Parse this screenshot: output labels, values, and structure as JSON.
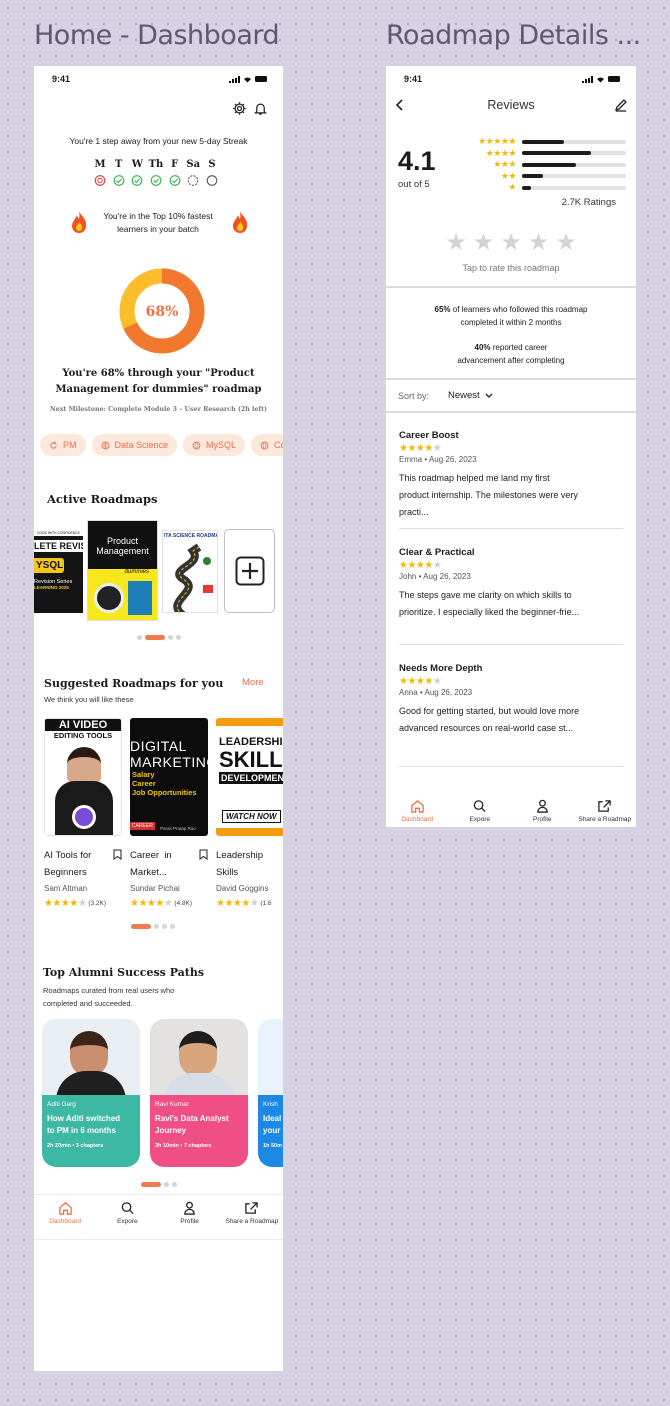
{
  "frames": {
    "home_title": "Home - Dashboard",
    "details_title": "Roadmap Details ..."
  },
  "colors": {
    "accent": "#EF6F45",
    "star": "#F5B800",
    "teal": "#3DB8A5",
    "pink": "#F04F86",
    "blue": "#1E88E5"
  },
  "home": {
    "time": "9:41",
    "streak_text": "You're 1 step away from your new 5-day Streak",
    "days": [
      "M",
      "T",
      "W",
      "Th",
      "F",
      "Sa",
      "S"
    ],
    "top_text_1": "You're in the Top 10% fastest",
    "top_text_2": "learners in your batch",
    "progress_label": "68%",
    "progress_value": 0.68,
    "progress_text_1": "You're 68% through your \"Product",
    "progress_text_2": "Management for dummies\" roadmap",
    "milestone": "Next Milestone: Complete Module 3 – User Research (2h left)",
    "chips": [
      "PM",
      "Data Science",
      "MySQL",
      "Co"
    ],
    "active_title": "Active Roadmaps",
    "books": {
      "mysql": {
        "top": "CODE WITH CONFIDENCE",
        "band": "LETE REVISI",
        "big": "YSQL",
        "note": "Revision Series",
        "year": "LEARNING 2025"
      },
      "pm": {
        "l1": "Product",
        "l2": "Management",
        "l3": "dummies"
      },
      "ds": {
        "title": "ITA SCIENCE ROADMA"
      }
    },
    "suggested": {
      "title": "Suggested Roadmaps for you",
      "more": "More",
      "subtitle": "We think you will like these",
      "items": [
        {
          "cover_1": "AI VIDEO",
          "cover_2": "EDITING TOOLS",
          "title_1": "AI Tools for",
          "title_2": "Beginners",
          "author": "Sam Altman",
          "count": "(3.2K)"
        },
        {
          "cover_1": "DIGITAL",
          "cover_2": "MARKETING",
          "cover_3": "Salary",
          "cover_4": "Career",
          "cover_5": "Job Opportunities",
          "cover_6": "CAREER",
          "cover_7": "Paras Pratap Rao",
          "title_1": "Career  in",
          "title_2": "Market...",
          "author": "Sundar Pichai",
          "count": "(4.8K)"
        },
        {
          "cover_1": "LEADERSHIP",
          "cover_2": "SKILLS",
          "cover_3": "DEVELOPMENT",
          "cover_4": "WATCH NOW",
          "title_1": "Leadership",
          "title_2": "Skills",
          "author": "David Goggins",
          "count": "(1.6"
        }
      ]
    },
    "alumni": {
      "title": "Top Alumni Success Paths",
      "subtitle_1": "Roadmaps curated from real users who",
      "subtitle_2": "completed and succeeded.",
      "items": [
        {
          "name": "Aditi Garg",
          "title_1": "How Aditi switched",
          "title_2": "to PM in 6 months",
          "meta": "2h 20min • 3 chapters"
        },
        {
          "name": "Ravi Kumar",
          "title_1": "Ravi's Data Analyst",
          "title_2": "Journey",
          "meta": "3h 10min • 7 chapters"
        },
        {
          "name": "Krish",
          "title_1": "Ideal",
          "title_2": "your",
          "meta": "1h 50m"
        }
      ]
    },
    "tabs": [
      "Dashboard",
      "Expore",
      "Profile",
      "Share a Roadmap"
    ]
  },
  "details": {
    "time": "9:41",
    "title": "Reviews",
    "rating": "4.1",
    "out_of": "out of 5",
    "ratings_count": "2.7K Ratings",
    "distribution": [
      0.4,
      0.66,
      0.52,
      0.2,
      0.09
    ],
    "tap_text": "Tap to rate this roadmap",
    "stat1_bold": "65%",
    "stat1_rest": " of learners who followed this roadmap",
    "stat1_line2": "completed it within 2 months",
    "stat2_bold": "40%",
    "stat2_rest": " reported career",
    "stat2_line2": "advancement after completing",
    "sort_label": "Sort by:",
    "sort_value": "Newest",
    "reviews": [
      {
        "title": "Career Boost",
        "author": "Emma",
        "date": "Aug 26, 2023",
        "line1": "This roadmap helped me land my first",
        "line2": "product internship. The milestones were very",
        "line3": "practi..."
      },
      {
        "title": "Clear & Practical",
        "author": "John",
        "date": "Aug 26, 2023",
        "line1": "The steps gave me clarity on which skills to",
        "line2": "prioritize. I especially liked the beginner-frie...",
        "line3": ""
      },
      {
        "title": "Needs More Depth",
        "author": "Anna",
        "date": "Aug 26, 2023",
        "line1": "Good for getting started, but would love more",
        "line2": "advanced resources on real-world case st...",
        "line3": ""
      }
    ],
    "tabs": [
      "Dashboard",
      "Expore",
      "Profile",
      "Share a Roadmap"
    ]
  }
}
